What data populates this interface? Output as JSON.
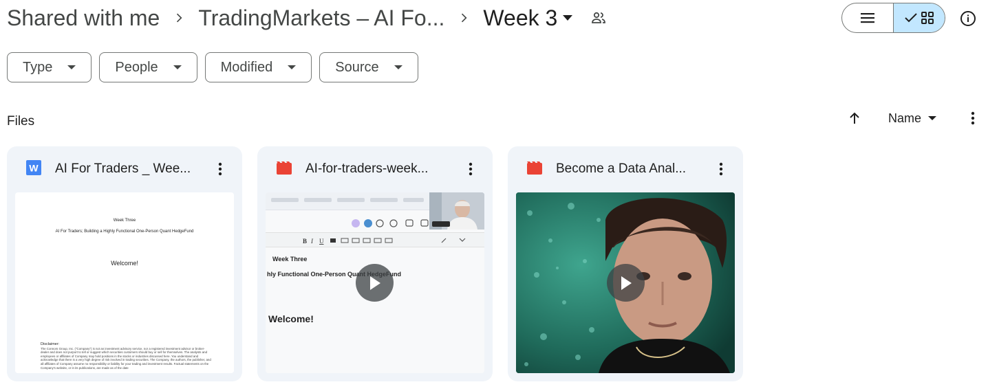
{
  "breadcrumb": {
    "root": "Shared with me",
    "parent": "TradingMarkets – AI Fo...",
    "current": "Week 3"
  },
  "filters": [
    {
      "label": "Type"
    },
    {
      "label": "People"
    },
    {
      "label": "Modified"
    },
    {
      "label": "Source"
    }
  ],
  "section": {
    "label": "Files",
    "sort_label": "Name"
  },
  "files": [
    {
      "name": "AI For Traders _ Wee...",
      "type_icon": "word-doc-icon",
      "thumb": {
        "heading": "Week Three",
        "subtitle": "AI For Traders; Building a Highly Functional One-Person Quant HedgeFund",
        "welcome": "Welcome!",
        "disclaimer_title": "Disclaimer:",
        "disclaimer_text": "The Connors Group, Inc. (\"Company\") is not an investment advisory service, nor a registered investment advisor or broker-dealer and does not purport to tell or suggest which securities customers should buy or sell for themselves. The analysts and employees or affiliates of Company may hold positions in the stocks or industries discussed here. You understand and acknowledge that there is a very high degree of risk involved in trading securities. The Company, the authors, the publisher, and all affiliates of Company assume no responsibility or liability for your trading and investment results. Factual statements on the Company's website, or in its publications, are made as of the date"
      }
    },
    {
      "name": "AI-for-traders-week...",
      "type_icon": "video-file-icon",
      "thumb": {
        "heading": "Week Three",
        "subtitle": "hly Functional One-Person Quant HedgeFund",
        "welcome": "Welcome!"
      }
    },
    {
      "name": "Become a Data Anal...",
      "type_icon": "video-file-icon"
    }
  ],
  "colors": {
    "accent_bg": "#c2e7ff",
    "card_bg": "#f0f4f9",
    "word_blue": "#4285f4",
    "video_red": "#ea4335"
  }
}
